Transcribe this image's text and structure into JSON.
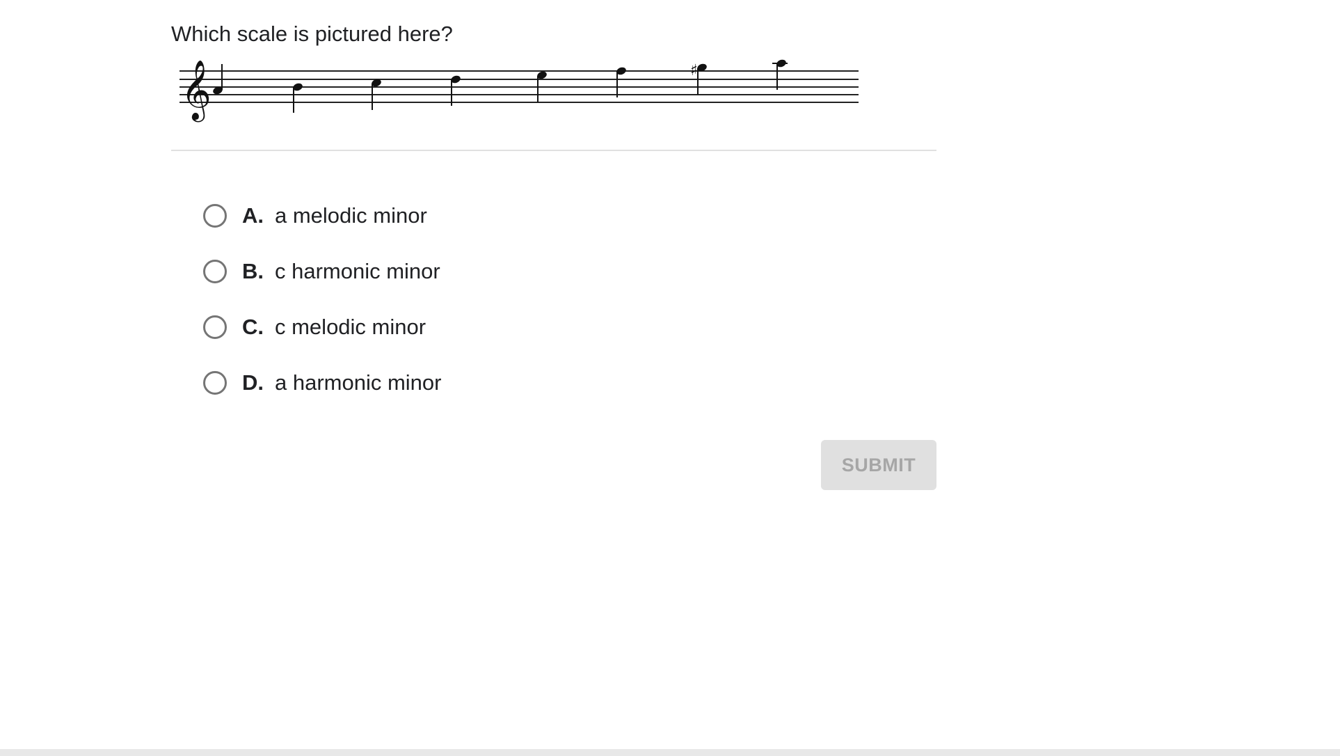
{
  "question": {
    "text": "Which scale is pictured here?"
  },
  "staff": {
    "clef": "treble-clef",
    "notes": [
      "A4",
      "B4",
      "C5",
      "D5",
      "E5",
      "F5",
      "G#5",
      "A5"
    ]
  },
  "options": [
    {
      "letter": "A.",
      "text": "a melodic minor"
    },
    {
      "letter": "B.",
      "text": "c harmonic minor"
    },
    {
      "letter": "C.",
      "text": "c melodic minor"
    },
    {
      "letter": "D.",
      "text": "a harmonic minor"
    }
  ],
  "submit": {
    "label": "SUBMIT",
    "enabled": false,
    "background": "#e0e0e0",
    "text_color": "#a6a6a6"
  }
}
